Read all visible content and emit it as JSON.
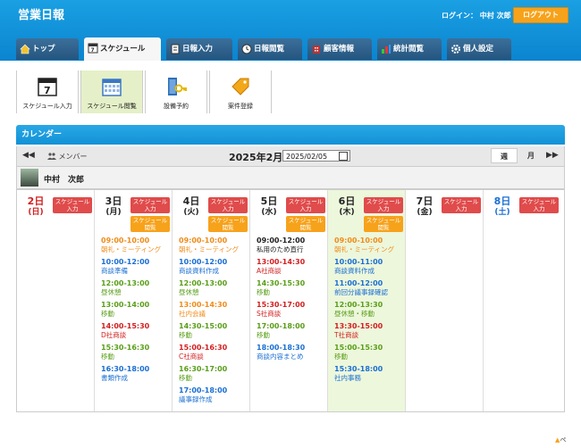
{
  "header": {
    "title": "営業日報",
    "login": "ログイン： 中村 次郎",
    "logout": "ログアウト"
  },
  "tabs": [
    {
      "label": "トップ",
      "icon": "home-icon"
    },
    {
      "label": "スケジュール",
      "icon": "calendar-icon",
      "active": true
    },
    {
      "label": "日報入力",
      "icon": "notebook-icon"
    },
    {
      "label": "日報閲覧",
      "icon": "clock-icon"
    },
    {
      "label": "顧客情報",
      "icon": "building-icon"
    },
    {
      "label": "統計閲覧",
      "icon": "chart-icon"
    },
    {
      "label": "個人設定",
      "icon": "gear-icon"
    }
  ],
  "toolbar": [
    {
      "label": "スケジュール入力",
      "icon": "calendar-7-icon"
    },
    {
      "label": "スケジュール閲覧",
      "icon": "calendar-grid-icon",
      "active": true
    },
    {
      "label": "設備予約",
      "icon": "key-icon"
    },
    {
      "label": "案件登録",
      "icon": "tag-icon"
    }
  ],
  "calendar": {
    "title": "カレンダー",
    "prev": "◀◀",
    "next": "▶▶",
    "member_label": "メンバー",
    "date_title": "2025年2月",
    "date_value": "2025/02/05",
    "week": "週",
    "month": "月",
    "user": "中村　次郎",
    "badge_input": "スケジュール入力",
    "badge_view": "スケジュール閲覧",
    "days": [
      {
        "date": "2日",
        "dow": "(日)",
        "cls": "sun",
        "view": false,
        "events": []
      },
      {
        "date": "3日",
        "dow": "(月)",
        "cls": "",
        "view": true,
        "events": [
          {
            "time": "09:00-10:00",
            "text": "朝礼・ミーティング",
            "color": "#f08c1a"
          },
          {
            "time": "10:00-12:00",
            "text": "商談準備",
            "color": "#1a6fd3"
          },
          {
            "time": "12:00-13:00",
            "text": "昼休憩",
            "color": "#5a9e1a"
          },
          {
            "time": "13:00-14:00",
            "text": "移動",
            "color": "#5a9e1a"
          },
          {
            "time": "14:00-15:30",
            "text": "D社商談",
            "color": "#d21f1f"
          },
          {
            "time": "15:30-16:30",
            "text": "移動",
            "color": "#5a9e1a"
          },
          {
            "time": "16:30-18:00",
            "text": "書類作成",
            "color": "#1a6fd3"
          }
        ]
      },
      {
        "date": "4日",
        "dow": "(火)",
        "cls": "",
        "view": true,
        "events": [
          {
            "time": "09:00-10:00",
            "text": "朝礼・ミーティング",
            "color": "#f08c1a"
          },
          {
            "time": "10:00-12:00",
            "text": "商談資料作成",
            "color": "#1a6fd3"
          },
          {
            "time": "12:00-13:00",
            "text": "昼休憩",
            "color": "#5a9e1a"
          },
          {
            "time": "13:00-14:30",
            "text": "社内会議",
            "color": "#f08c1a"
          },
          {
            "time": "14:30-15:00",
            "text": "移動",
            "color": "#5a9e1a"
          },
          {
            "time": "15:00-16:30",
            "text": "C社商談",
            "color": "#d21f1f"
          },
          {
            "time": "16:30-17:00",
            "text": "移動",
            "color": "#5a9e1a"
          },
          {
            "time": "17:00-18:00",
            "text": "議事録作成",
            "color": "#1a6fd3"
          }
        ]
      },
      {
        "date": "5日",
        "dow": "(水)",
        "cls": "",
        "view": true,
        "events": [
          {
            "time": "09:00-12:00",
            "text": "私用のため直行",
            "color": "#222222"
          },
          {
            "time": "13:00-14:30",
            "text": "A社商談",
            "color": "#d21f1f"
          },
          {
            "time": "14:30-15:30",
            "text": "移動",
            "color": "#5a9e1a"
          },
          {
            "time": "15:30-17:00",
            "text": "S社商談",
            "color": "#d21f1f"
          },
          {
            "time": "17:00-18:00",
            "text": "移動",
            "color": "#5a9e1a"
          },
          {
            "time": "18:00-18:30",
            "text": "商談内容まとめ",
            "color": "#1a6fd3"
          }
        ]
      },
      {
        "date": "6日",
        "dow": "(木)",
        "cls": "",
        "view": true,
        "today": true,
        "events": [
          {
            "time": "09:00-10:00",
            "text": "朝礼・ミーティング",
            "color": "#f08c1a"
          },
          {
            "time": "10:00-11:00",
            "text": "商談資料作成",
            "color": "#1a6fd3"
          },
          {
            "time": "11:00-12:00",
            "text": "前回分議事録確認",
            "color": "#1a6fd3"
          },
          {
            "time": "12:00-13:30",
            "text": "昼休憩・移動",
            "color": "#5a9e1a"
          },
          {
            "time": "13:30-15:00",
            "text": "T社商談",
            "color": "#d21f1f"
          },
          {
            "time": "15:00-15:30",
            "text": "移動",
            "color": "#5a9e1a"
          },
          {
            "time": "15:30-18:00",
            "text": "社内事務",
            "color": "#1a6fd3"
          }
        ]
      },
      {
        "date": "7日",
        "dow": "(金)",
        "cls": "",
        "view": false,
        "events": []
      },
      {
        "date": "8日",
        "dow": "(土)",
        "cls": "sat",
        "view": false,
        "events": []
      }
    ]
  },
  "footnote": "ペ"
}
